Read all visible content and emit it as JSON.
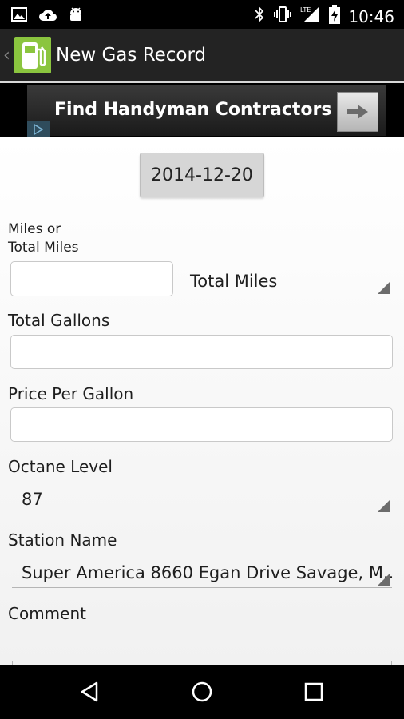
{
  "status_bar": {
    "time": "10:46",
    "icons": [
      "image-icon",
      "cloud-upload-icon",
      "android-icon",
      "bluetooth-icon",
      "vibrate-icon",
      "lte-signal-icon",
      "battery-charging-icon"
    ]
  },
  "action_bar": {
    "title": "New Gas Record",
    "app_icon": "gas-pump-icon"
  },
  "ad": {
    "text": "Find Handyman Contractors",
    "arrow_icon": "arrow-right-icon",
    "badge_icon": "play-triangle-icon"
  },
  "form": {
    "date": "2014-12-20",
    "miles_label_line1": "Miles or",
    "miles_label_line2": "Total Miles",
    "miles_value": "",
    "miles_mode": "Total Miles",
    "gallons_label": "Total Gallons",
    "gallons_value": "",
    "price_label": "Price Per Gallon",
    "price_value": "",
    "octane_label": "Octane Level",
    "octane_value": "87",
    "station_label": "Station Name",
    "station_value": "Super America 8660 Egan Drive Savage, M..",
    "comment_label": "Comment"
  },
  "nav_bar": {
    "icons": [
      "back-icon",
      "home-icon",
      "recents-icon"
    ]
  }
}
